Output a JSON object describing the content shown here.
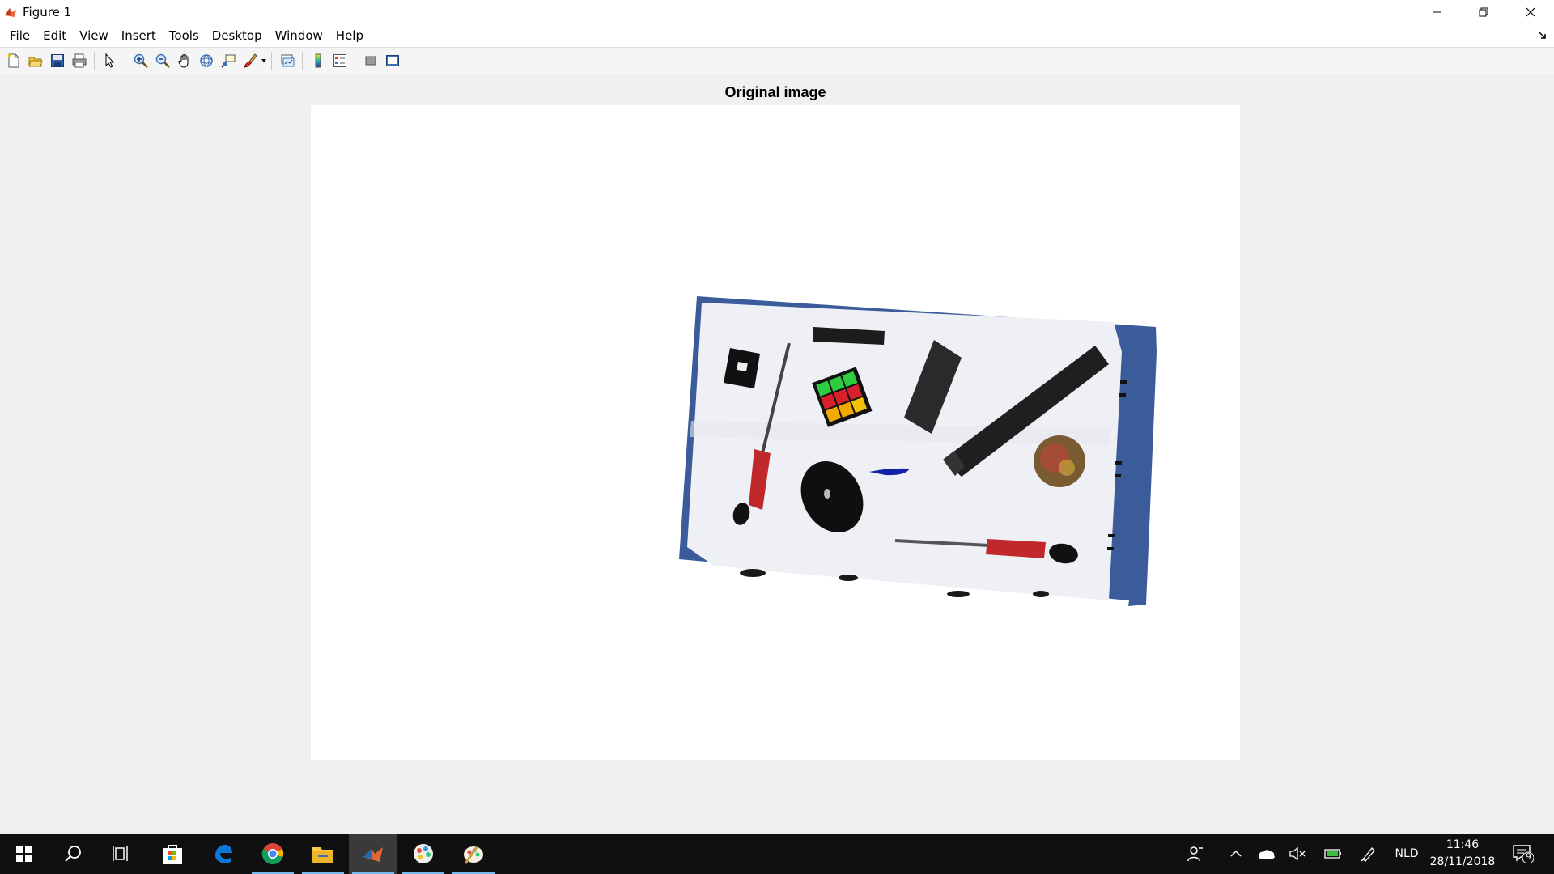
{
  "window": {
    "title": "Figure 1",
    "icon": "matlab-icon",
    "controls": [
      "minimize-icon",
      "restore-icon",
      "close-icon"
    ]
  },
  "menu": {
    "items": [
      "File",
      "Edit",
      "View",
      "Insert",
      "Tools",
      "Desktop",
      "Window",
      "Help"
    ]
  },
  "toolbar": {
    "buttons": [
      "new-figure-icon",
      "open-file-icon",
      "save-icon",
      "print-icon",
      "edit-plot-icon",
      "zoom-in-icon",
      "zoom-out-icon",
      "pan-icon",
      "rotate-3d-icon",
      "data-cursor-icon",
      "brush-icon",
      "link-plot-icon",
      "colorbar-icon",
      "legend-icon",
      "hide-plot-tools-icon",
      "show-plot-tools-icon"
    ]
  },
  "figure": {
    "title": "Original image",
    "image_description_icon": "photo-image",
    "background": "#ffffff"
  },
  "taskbar": {
    "apps": [
      "windows-start-icon",
      "search-icon",
      "task-view-icon",
      "store-icon",
      "edge-icon",
      "chrome-icon",
      "file-explorer-icon",
      "matlab-icon",
      "paint-3d-icon",
      "paint-icon"
    ],
    "active_app": "matlab-icon",
    "tray": {
      "language": "NLD",
      "time": "11:46",
      "date": "28/11/2018",
      "notifications": "9"
    }
  },
  "colors": {
    "taskbar_bg": "#101010",
    "accent": "#76b9ed",
    "window_bg": "#f0f0f0"
  }
}
